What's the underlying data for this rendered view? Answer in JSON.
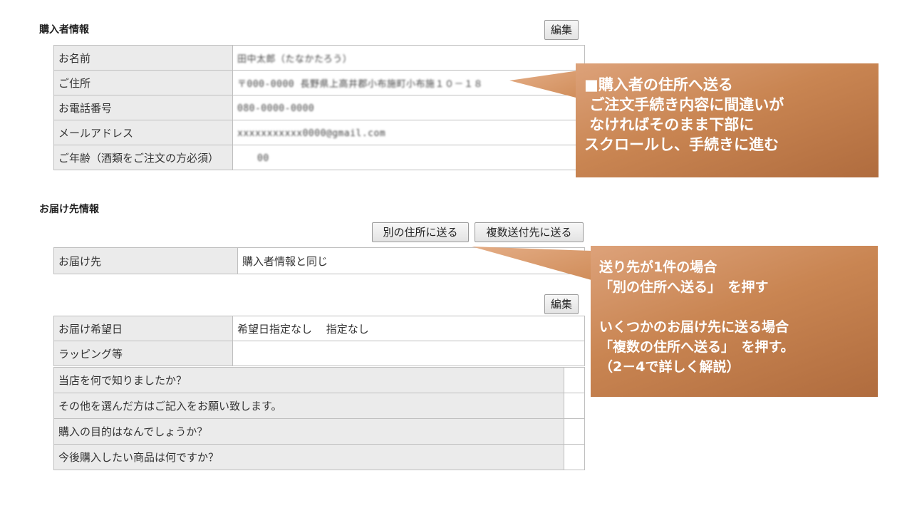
{
  "buyer_section": {
    "title": "購入者情報",
    "edit_label": "編集",
    "rows": [
      {
        "label": "お名前",
        "value": "田中太郎（たなかたろう）"
      },
      {
        "label": "ご住所",
        "value": "〒000-0000 長野県上高井郡小布施町小布施１０－１８"
      },
      {
        "label": "お電話番号",
        "value": "080-0000-0000"
      },
      {
        "label": "メールアドレス",
        "value": "xxxxxxxxxxx0000@gmail.com"
      },
      {
        "label": "ご年齢（酒類をご注文の方必須）",
        "value": "00"
      }
    ]
  },
  "delivery_section": {
    "title": "お届け先情報",
    "other_address_label": "別の住所に送る",
    "multiple_address_label": "複数送付先に送る",
    "destination_label": "お届け先",
    "destination_value": "購入者情報と同じ"
  },
  "order_section": {
    "edit_label": "編集",
    "rows": [
      {
        "label": "お届け希望日",
        "value": "希望日指定なし　 指定なし"
      },
      {
        "label": "ラッピング等",
        "value": ""
      }
    ],
    "questions": [
      {
        "label": "当店を何で知りましたか？",
        "value": ""
      },
      {
        "label": "その他を選んだ方はご記入をお願い致します。",
        "value": ""
      },
      {
        "label": "購入の目的はなんでしょうか？",
        "value": ""
      },
      {
        "label": "今後購入したい商品は何ですか？",
        "value": ""
      }
    ]
  },
  "callout_1": {
    "lines": [
      "■購入者の住所へ送る",
      " ご注文手続き内容に間違いが",
      " なければそのまま下部に",
      "スクロールし、手続きに進む"
    ]
  },
  "callout_2": {
    "lines": [
      "送り先が1件の場合",
      "「別の住所へ送る」　を押す",
      "",
      "いくつかのお届け先に送る場合",
      "「複数の住所へ送る」　を押す。",
      "（2－4で詳しく解説）"
    ]
  },
  "colors": {
    "callout_light": "#dda27a",
    "callout_dark": "#b06c3e",
    "label_bg": "#ebebeb",
    "border": "#bfbfbf"
  }
}
